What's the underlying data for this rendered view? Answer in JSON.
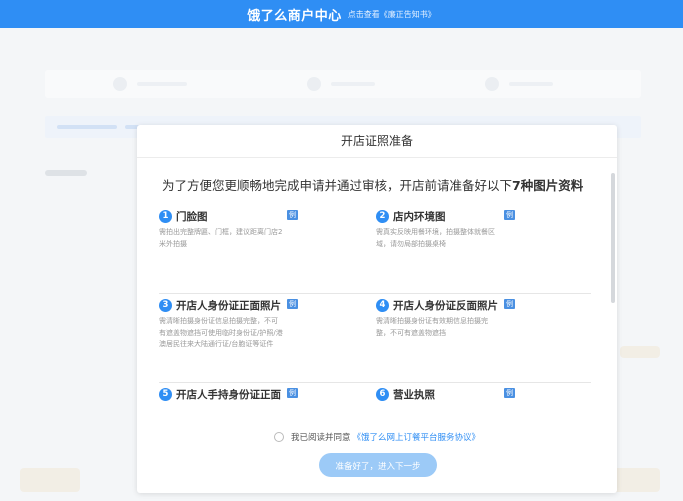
{
  "header": {
    "brand": "饿了么商户中心",
    "notice_link": "点击查看《廉正告知书》"
  },
  "modal": {
    "title": "开店证照准备",
    "intro_prefix": "为了方便您更顺畅地完成申请并通过审核，开店前请准备好以下",
    "intro_highlight": "7种图片资料",
    "example_label": "例",
    "items": [
      {
        "num": "1",
        "title": "门脸图",
        "desc": "需拍出完整牌匾、门框，建议距离门店2米外拍摄"
      },
      {
        "num": "2",
        "title": "店内环境图",
        "desc": "需真实反映用餐环境，拍摄整体就餐区域，请勿局部拍摄桌椅"
      },
      {
        "num": "3",
        "title": "开店人身份证正面照片",
        "desc": "需清晰拍摄身份证信息拍摄完整，不可有遮盖物遮挡可使用临时身份证/护照/港澳居民往来大陆通行证/台胞证等证件"
      },
      {
        "num": "4",
        "title": "开店人身份证反面照片",
        "desc": "需清晰拍摄身份证有效期信息拍摄完整，不可有遮盖物遮挡"
      },
      {
        "num": "5",
        "title": "开店人手持身份证正面",
        "desc": ""
      },
      {
        "num": "6",
        "title": "营业执照",
        "desc": ""
      }
    ],
    "agree_text": "我已阅读并同意",
    "agree_link": "《饿了么网上订餐平台服务协议》",
    "next_button": "准备好了，进入下一步"
  },
  "colors": {
    "header_blue": "#2f8ef4",
    "button_disabled": "#9ccaf7",
    "number_badge": "#2f8ef4"
  }
}
